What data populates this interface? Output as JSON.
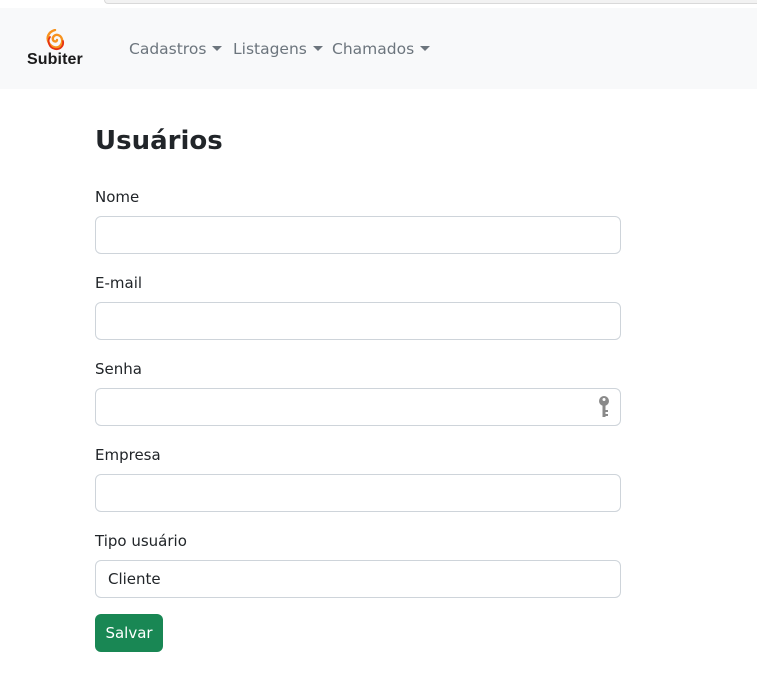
{
  "navbar": {
    "brand_name": "Subiter",
    "menu": [
      {
        "label": "Cadastros"
      },
      {
        "label": "Listagens"
      },
      {
        "label": "Chamados"
      }
    ]
  },
  "page": {
    "title": "Usuários"
  },
  "form": {
    "nome": {
      "label": "Nome",
      "value": ""
    },
    "email": {
      "label": "E-mail",
      "value": ""
    },
    "senha": {
      "label": "Senha",
      "value": ""
    },
    "empresa": {
      "label": "Empresa",
      "value": ""
    },
    "tipo_usuario": {
      "label": "Tipo usuário",
      "selected": "Cliente"
    },
    "save_label": "Salvar"
  },
  "colors": {
    "navbar_bg": "#f8f9fa",
    "nav_link": "#6c757d",
    "save_button": "#198754",
    "logo_orange": "#f7931e",
    "logo_red": "#e63312"
  }
}
